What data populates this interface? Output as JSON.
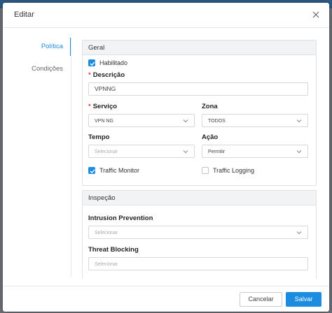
{
  "modal": {
    "title": "Editar"
  },
  "nav": {
    "items": [
      {
        "label": "Política",
        "active": true
      },
      {
        "label": "Condições",
        "active": false
      }
    ]
  },
  "general": {
    "header": "Geral",
    "enabled": {
      "label": "Habilitado",
      "checked": true
    },
    "descricao": {
      "label": "Descrição",
      "value": "VPNNG"
    },
    "servico": {
      "label": "Serviço",
      "value": "VPN NG"
    },
    "zona": {
      "label": "Zona",
      "value": "TODOS"
    },
    "tempo": {
      "label": "Tempo",
      "placeholder": "Selecionar"
    },
    "acao": {
      "label": "Ação",
      "value": "Permitir"
    },
    "traffic_monitor": {
      "label": "Traffic Monitor",
      "checked": true
    },
    "traffic_logging": {
      "label": "Traffic Logging",
      "checked": false
    }
  },
  "inspecao": {
    "header": "Inspeção",
    "intrusion": {
      "label": "Intrusion Prevention",
      "placeholder": "Selecionar"
    },
    "threat": {
      "label": "Threat Blocking",
      "placeholder": "Selecionar"
    }
  },
  "footer": {
    "cancel_label": "Cancelar",
    "save_label": "Salvar"
  },
  "colors": {
    "accent": "#1d8ce0",
    "required": "#e04040"
  }
}
